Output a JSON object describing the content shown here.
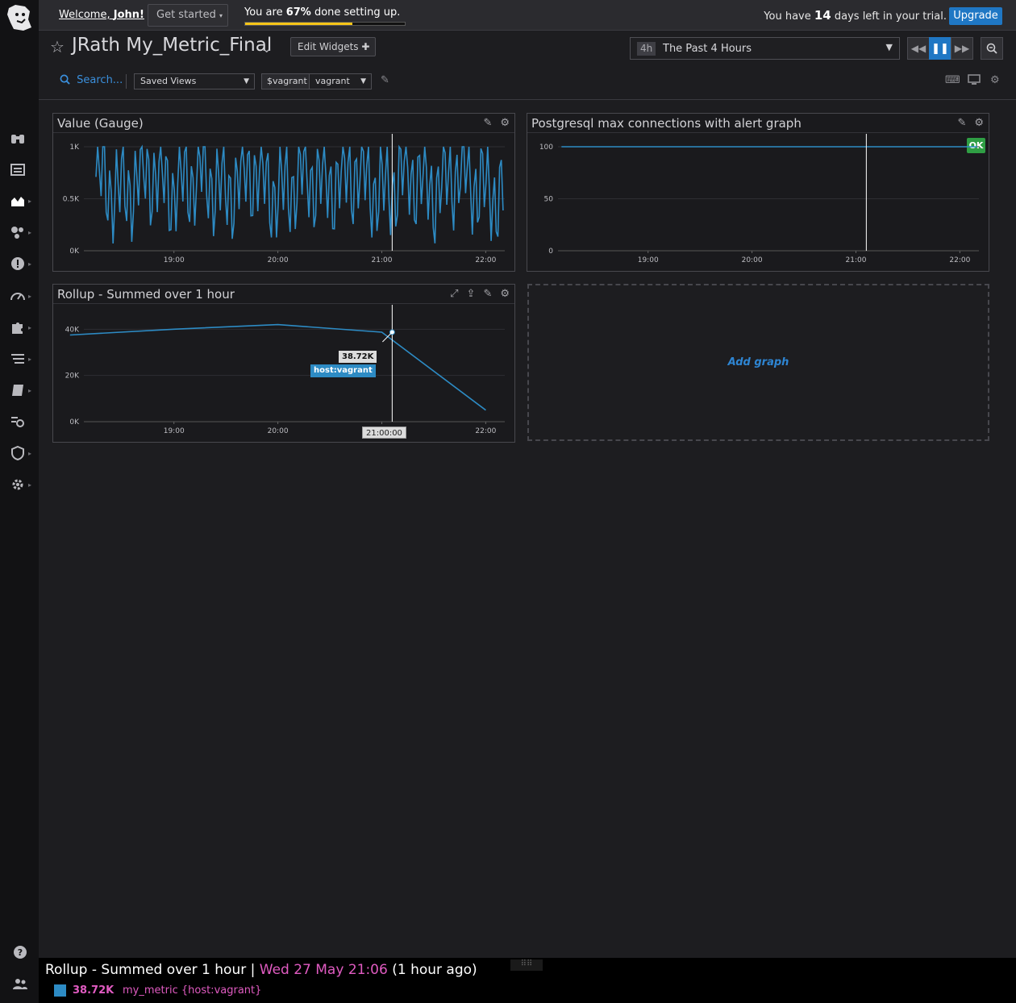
{
  "topbar": {
    "welcome_prefix": "Welcome, ",
    "welcome_name": "John!",
    "get_started": "Get started",
    "progress_prefix": "You are ",
    "progress_pct_label": "67%",
    "progress_suffix": " done setting up.",
    "progress_fraction": 0.67,
    "trial_prefix": "You have ",
    "trial_days": "14",
    "trial_suffix": " days left in your trial.",
    "upgrade": "Upgrade"
  },
  "header": {
    "title": "JRath My_Metric_Final",
    "edit_widgets": "Edit Widgets",
    "time_badge": "4h",
    "time_label": "The Past 4 Hours",
    "search_placeholder": "Search...",
    "saved_views": "Saved Views",
    "var_name": "$vagrant",
    "var_value": "vagrant"
  },
  "widgets": {
    "gauge": {
      "title": "Value (Gauge)"
    },
    "postgres": {
      "title": "Postgresql max connections with alert graph",
      "status": "OK"
    },
    "rollup": {
      "title": "Rollup - Summed over 1 hour",
      "tooltip_value": "38.72K",
      "tooltip_tag": "host:vagrant",
      "cursor_time": "21:00:00"
    },
    "add_graph": "Add graph"
  },
  "chart_data": [
    {
      "type": "line",
      "title": "Value (Gauge)",
      "x": [
        "18:15",
        "18:30",
        "18:45",
        "19:00",
        "19:15",
        "19:30",
        "19:45",
        "20:00",
        "20:15",
        "20:30",
        "20:45",
        "21:00",
        "21:15",
        "21:30",
        "21:45",
        "22:00",
        "22:10"
      ],
      "x_ticks": [
        "19:00",
        "20:00",
        "21:00",
        "22:00"
      ],
      "y_ticks": [
        "0K",
        "0.5K",
        "1K"
      ],
      "ylim": [
        0,
        1000
      ],
      "series": [
        {
          "values": [
            700,
            150,
            900,
            300,
            850,
            200,
            950,
            100,
            800,
            450,
            900,
            150,
            850,
            250,
            950,
            200,
            150
          ]
        }
      ],
      "color": "#2d8bc4",
      "grid": true
    },
    {
      "type": "line",
      "title": "Postgresql max connections with alert graph",
      "x": [
        "18:10",
        "22:10"
      ],
      "x_ticks": [
        "19:00",
        "20:00",
        "21:00",
        "22:00"
      ],
      "y_ticks": [
        "0",
        "50",
        "100"
      ],
      "ylim": [
        0,
        100
      ],
      "series": [
        {
          "values": [
            100,
            100
          ]
        }
      ],
      "color": "#2d8bc4",
      "grid": true
    },
    {
      "type": "line",
      "title": "Rollup - Summed over 1 hour",
      "x": [
        "18:00",
        "19:00",
        "20:00",
        "21:00",
        "22:00"
      ],
      "x_ticks": [
        "19:00",
        "20:00",
        "21:00",
        "22:00"
      ],
      "y_ticks": [
        "0K",
        "20K",
        "40K"
      ],
      "ylim": [
        0,
        45000
      ],
      "series": [
        {
          "name": "host:vagrant",
          "values": [
            37500,
            40000,
            42000,
            38720,
            5000
          ]
        }
      ],
      "color": "#2d8bc4",
      "grid": true
    }
  ],
  "footer": {
    "title": "Rollup - Summed over 1 hour",
    "separator": " | ",
    "date": "Wed 27 May 21:06",
    "ago": " (1 hour ago)",
    "value": "38.72K",
    "metric": "my_metric {host:vagrant}"
  }
}
